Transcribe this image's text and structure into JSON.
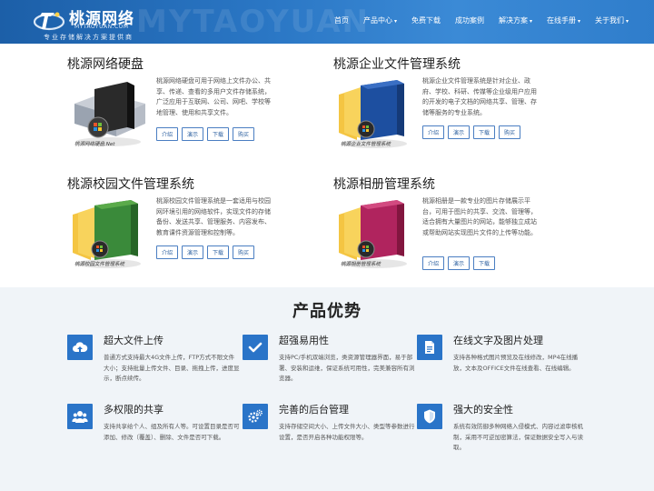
{
  "header": {
    "logo_title": "桃源网络",
    "logo_sub": "MYTAOYUAN.COM",
    "logo_slogan": "专业存储解决方案提供商",
    "watermark": "MYTAOYUAN",
    "nav": [
      {
        "label": "首页",
        "has_caret": false
      },
      {
        "label": "产品中心",
        "has_caret": true
      },
      {
        "label": "免费下载",
        "has_caret": false
      },
      {
        "label": "成功案例",
        "has_caret": false
      },
      {
        "label": "解决方案",
        "has_caret": true
      },
      {
        "label": "在线手册",
        "has_caret": true
      },
      {
        "label": "关于我们",
        "has_caret": true
      }
    ],
    "caret": "▾"
  },
  "products": [
    {
      "title": "桃源网络硬盘",
      "caption": "桃源网络硬盘.Net",
      "box_color": "#2a2a2a",
      "description": "桃源网络硬盘可用于网络上文件办公、共享、传递、查看的多用户文件存储系统，广泛应用于互联网、公司、网吧、学校等地管理、使用和共享文件。",
      "buttons": [
        "介绍",
        "演示",
        "下载",
        "购买"
      ]
    },
    {
      "title": "桃源企业文件管理系统",
      "caption": "桃源企业文件管理系统",
      "box_color": "#1d4fa0",
      "description": "桃源企业文件管理系统是针对企业、政府、学校、科研、传媒等企业级用户应用的开发的电子文档的网络共享、管理、存储等服务的专业系统。",
      "buttons": [
        "介绍",
        "演示",
        "下载",
        "购买"
      ]
    },
    {
      "title": "桃源校园文件管理系统",
      "caption": "桃源校园文件管理系统",
      "box_color": "#3a8a3a",
      "description": "桃源校园文件管理系统是一套适用与校园网环境引用的网络软件，实现文件的存储备份、发送共享、管理服务、内容发布、教育课件资源管理和控制等。",
      "buttons": [
        "介绍",
        "演示",
        "下载",
        "购买"
      ]
    },
    {
      "title": "桃源相册管理系统",
      "caption": "桃源相册管理系统",
      "box_color": "#b0245e",
      "description": "桃源相册是一款专业的图片存储展示平台，可用于图片的共享、交流、管理等，适合拥有大量图片的网站，能够独立成站或帮助网站实现图片文件的上传等功能。",
      "buttons": [
        "介绍",
        "演示",
        "下载"
      ]
    }
  ],
  "advantages": {
    "title": "产品优势",
    "accent": "#2a74c8",
    "features": [
      {
        "icon": "cloud-upload-icon",
        "title": "超大文件上传",
        "desc": "普通方式支持最大4G文件上传，FTP方式不限文件大小；支持批量上传文件、目录、拖拽上传，进度显示，断点续传。"
      },
      {
        "icon": "check-icon",
        "title": "超强易用性",
        "desc": "支持PC/手机双端浏览，类资源管理器界面，易于部署、安装和运维，保证系统可用性，完美兼容所有浏览器。"
      },
      {
        "icon": "document-icon",
        "title": "在线文字及图片处理",
        "desc": "支持各种格式图片预览及在线修改，MP4在线播放，文本及OFFICE文件在线查看、在线编辑。"
      },
      {
        "icon": "users-icon",
        "title": "多权限的共享",
        "desc": "支持共享给个人、组及所有人等。可设置目录是否可添加、修改（覆盖）、删除、文件是否可下载。"
      },
      {
        "icon": "gears-icon",
        "title": "完善的后台管理",
        "desc": "支持存储空间大小、上传文件大小、类型等参数进行设置，是否开启各种功能权限等。"
      },
      {
        "icon": "shield-icon",
        "title": "强大的安全性",
        "desc": "系统有效防御多种网络入侵模式、内容过滤审核机制，采用不可逆加密算法，保证数据安全写入与读取。"
      }
    ]
  }
}
